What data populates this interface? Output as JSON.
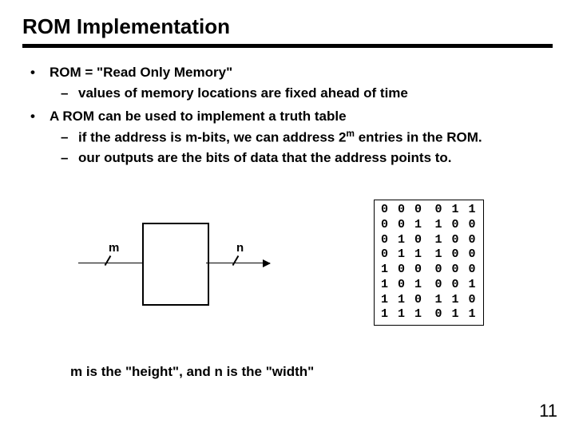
{
  "title": "ROM Implementation",
  "bullets": {
    "b1": "ROM = \"Read Only Memory\"",
    "b1a": "values of memory locations are fixed ahead of time",
    "b2": "A ROM can be used to implement a truth table",
    "b2a_pre": "if the address is m-bits, we can address 2",
    "b2a_sup": "m",
    "b2a_post": " entries in the ROM.",
    "b2b": "our outputs are the bits of data that the address points to."
  },
  "fig": {
    "m": "m",
    "n": "n"
  },
  "table": {
    "rows": [
      [
        "0",
        "0",
        "0",
        "0",
        "1",
        "1"
      ],
      [
        "0",
        "0",
        "1",
        "1",
        "0",
        "0"
      ],
      [
        "0",
        "1",
        "0",
        "1",
        "0",
        "0"
      ],
      [
        "0",
        "1",
        "1",
        "1",
        "0",
        "0"
      ],
      [
        "1",
        "0",
        "0",
        "0",
        "0",
        "0"
      ],
      [
        "1",
        "0",
        "1",
        "0",
        "0",
        "1"
      ],
      [
        "1",
        "1",
        "0",
        "1",
        "1",
        "0"
      ],
      [
        "1",
        "1",
        "1",
        "0",
        "1",
        "1"
      ]
    ]
  },
  "caption": "m is the \"height\", and n is the \"width\"",
  "page": "11"
}
